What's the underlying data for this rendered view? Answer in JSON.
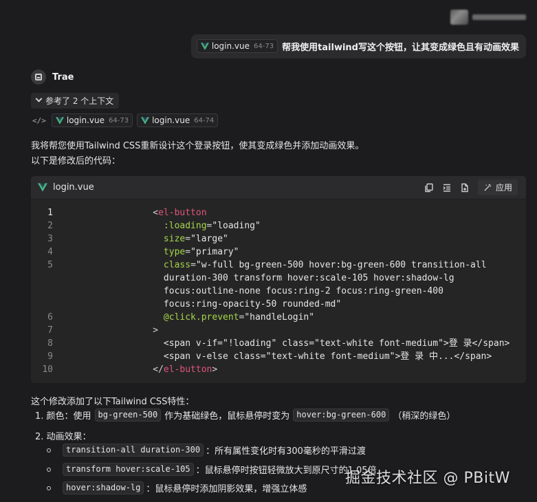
{
  "user_message": {
    "file_chip": {
      "name": "login.vue",
      "range": "64-73"
    },
    "text": "帮我使用tailwind写这个按钮，让其变成绿色且有动画效果"
  },
  "assistant": {
    "name": "Trae",
    "context_toggle": "参考了 2 个上下文",
    "context_files": [
      {
        "name": "login.vue",
        "range": "64-73"
      },
      {
        "name": "login.vue",
        "range": "64-74"
      }
    ],
    "intro_lines": [
      "我将帮您使用Tailwind CSS重新设计这个登录按钮，使其变成绿色并添加动画效果。",
      "以下是修改后的代码："
    ]
  },
  "code_block": {
    "filename": "login.vue",
    "apply_label": "应用",
    "actions": [
      "copy-icon",
      "insert-icon",
      "new-file-icon",
      "apply-wand-icon"
    ],
    "line_numbers": [
      "1",
      "2",
      "3",
      "4",
      "5",
      "",
      "",
      "",
      "6",
      "7",
      "8",
      "9",
      "10"
    ],
    "active_line": "1"
  },
  "explanation": {
    "heading": "这个修改添加了以下Tailwind CSS特性：",
    "item1": {
      "label": "1. 颜色：使用",
      "code1": "bg-green-500",
      "mid": "作为基础绿色，鼠标悬停时变为",
      "code2": "hover:bg-green-600",
      "tail": "（稍深的绿色）"
    },
    "item2_label": "2. 动画效果：",
    "sub_items": [
      {
        "code": "transition-all duration-300",
        "text": "：所有属性变化时有300毫秒的平滑过渡"
      },
      {
        "code": "transform hover:scale-105",
        "text": "：鼠标悬停时按钮轻微放大到原尺寸的1.05倍"
      },
      {
        "code": "hover:shadow-lg",
        "text": "：鼠标悬停时添加阴影效果，增强立体感"
      }
    ]
  },
  "watermark": "掘金技术社区 @ PBitW",
  "colors": {
    "background": "#1c1c1f",
    "code_bg": "#252526",
    "tag": "#e0557a",
    "attr": "#a6d64a",
    "vue_green": "#42b883"
  }
}
